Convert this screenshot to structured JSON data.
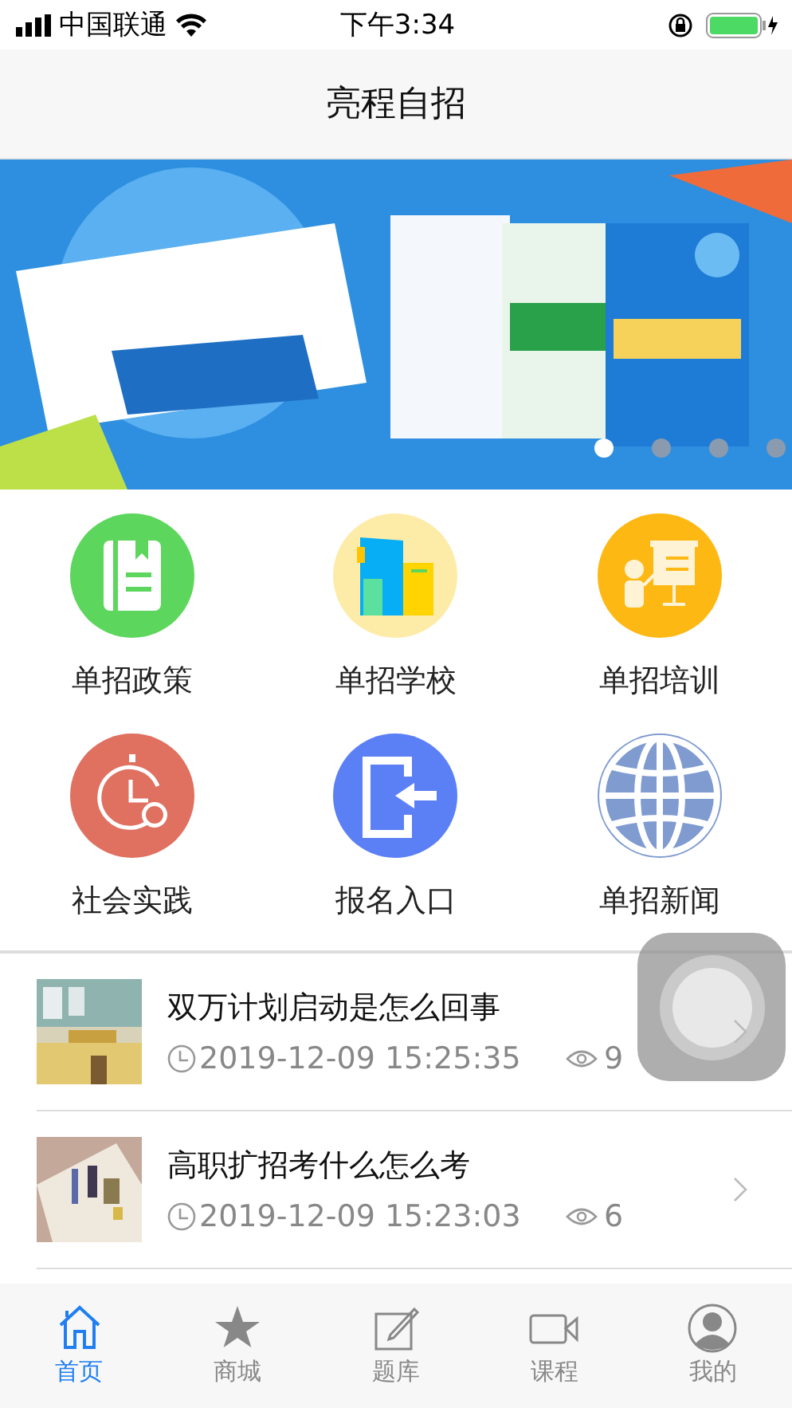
{
  "status_bar": {
    "carrier": "中国联通",
    "time": "下午3:34"
  },
  "nav_bar": {
    "title": "亮程自招"
  },
  "banner": {
    "kind": "picture",
    "slides": [
      {
        "selected": true
      },
      {
        "selected": false
      },
      {
        "selected": false
      },
      {
        "selected": false
      }
    ]
  },
  "shortcuts": [
    {
      "label": "单招政策",
      "kind": "policy",
      "color": "#5cd65c"
    },
    {
      "label": "单招学校",
      "kind": "school",
      "color": "#fdeca8"
    },
    {
      "label": "单招培训",
      "kind": "training",
      "color": "#fdb813"
    },
    {
      "label": "社会实践",
      "kind": "practice",
      "color": "#e07060"
    },
    {
      "label": "报名入口",
      "kind": "signup",
      "color": "#5b7ff5"
    },
    {
      "label": "单招新闻",
      "kind": "news",
      "color": "#7f9bd0"
    }
  ],
  "news": [
    {
      "title": "双万计划启动是怎么回事",
      "time": "2019-12-09 15:25:35",
      "views": "9"
    },
    {
      "title": "高职扩招考什么怎么考",
      "time": "2019-12-09 15:23:03",
      "views": "6"
    }
  ],
  "tab_bar": [
    {
      "label": "首页",
      "kind": "home",
      "selected": true
    },
    {
      "label": "商城",
      "kind": "star",
      "selected": false
    },
    {
      "label": "题库",
      "kind": "edit",
      "selected": false
    },
    {
      "label": "课程",
      "kind": "video",
      "selected": false
    },
    {
      "label": "我的",
      "kind": "user",
      "selected": false
    }
  ]
}
